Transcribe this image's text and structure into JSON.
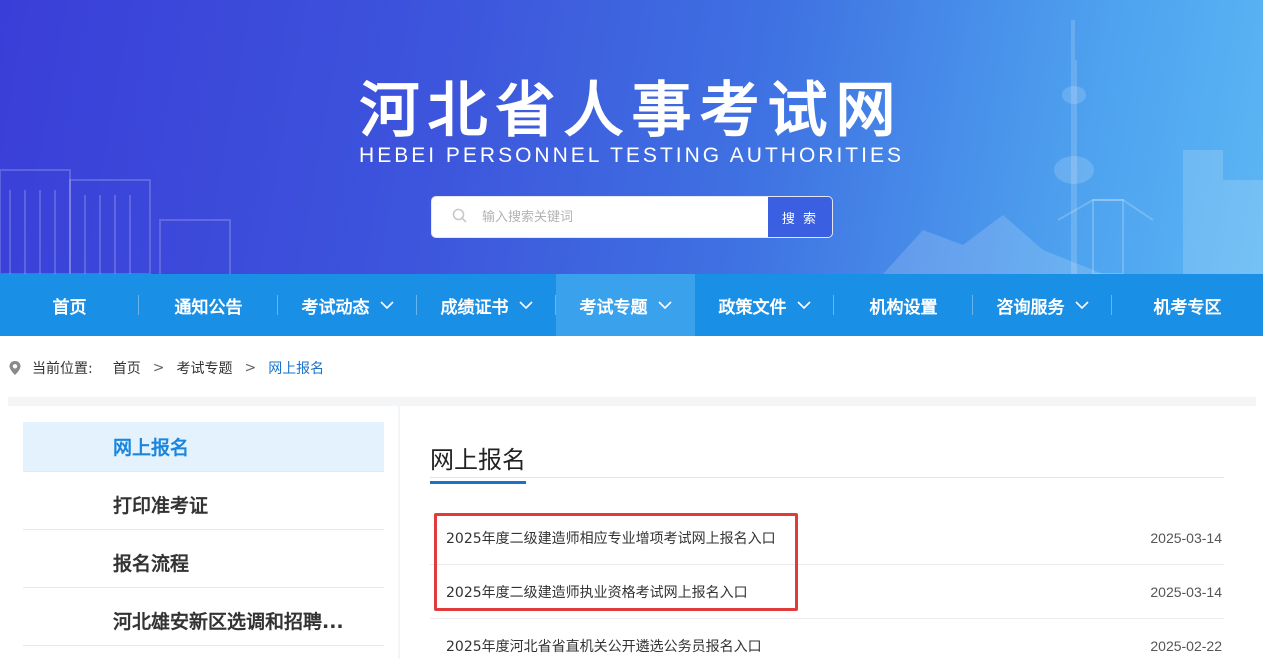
{
  "header": {
    "title": "河北省人事考试网",
    "subtitle": "HEBEI PERSONNEL TESTING AUTHORITIES",
    "search_placeholder": "输入搜索关键词",
    "search_button": "搜 索"
  },
  "nav": {
    "items": [
      {
        "label": "首页",
        "has_dropdown": false
      },
      {
        "label": "通知公告",
        "has_dropdown": false
      },
      {
        "label": "考试动态",
        "has_dropdown": true
      },
      {
        "label": "成绩证书",
        "has_dropdown": true
      },
      {
        "label": "考试专题",
        "has_dropdown": true,
        "active": true
      },
      {
        "label": "政策文件",
        "has_dropdown": true
      },
      {
        "label": "机构设置",
        "has_dropdown": false
      },
      {
        "label": "咨询服务",
        "has_dropdown": true
      },
      {
        "label": "机考专区",
        "has_dropdown": false
      }
    ]
  },
  "breadcrumb": {
    "prefix": "当前位置:",
    "items": [
      "首页",
      "考试专题",
      "网上报名"
    ],
    "separator": ">"
  },
  "sidebar": {
    "items": [
      {
        "label": "网上报名",
        "active": true
      },
      {
        "label": "打印准考证",
        "active": false
      },
      {
        "label": "报名流程",
        "active": false
      },
      {
        "label": "河北雄安新区选调和招聘...",
        "active": false
      }
    ]
  },
  "main": {
    "title": "网上报名",
    "list": [
      {
        "title": "2025年度二级建造师相应专业增项考试网上报名入口",
        "date": "2025-03-14"
      },
      {
        "title": "2025年度二级建造师执业资格考试网上报名入口",
        "date": "2025-03-14"
      },
      {
        "title": "2025年度河北省省直机关公开遴选公务员报名入口",
        "date": "2025-02-22"
      }
    ]
  },
  "colors": {
    "nav_bg": "#1a8fe6",
    "nav_active": "#3aa1ec",
    "accent": "#1a73c9",
    "highlight": "#e13b3b"
  }
}
